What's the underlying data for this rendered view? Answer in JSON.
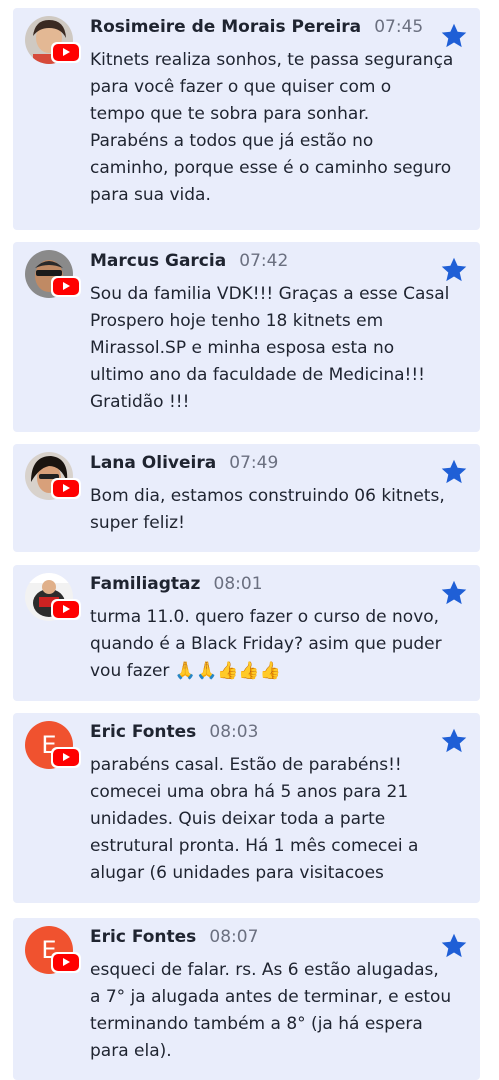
{
  "colors": {
    "card_bg": "#e9edfb",
    "star": "#1f5fd6",
    "youtube_red": "#ff0000",
    "avatar_letter_bg": "#f0522f"
  },
  "comments": [
    {
      "name": "Rosimeire de Morais Pereira",
      "time": "07:45",
      "lines": [
        "Kitnets realiza sonhos, te passa segurança",
        "para você fazer o que quiser com o",
        "tempo que te sobra para sonhar.",
        "Parabéns a todos que já estão no",
        "caminho, porque esse é o caminho seguro",
        "para sua vida."
      ],
      "avatar": "photo"
    },
    {
      "name": "Marcus Garcia",
      "time": "07:42",
      "lines": [
        "Sou da familia VDK!!! Graças a esse Casal",
        "Prospero hoje tenho 18 kitnets em",
        "Mirassol.SP e minha esposa esta no",
        "ultimo ano da faculdade de Medicina!!!",
        "Gratidão !!!"
      ],
      "avatar": "photo"
    },
    {
      "name": "Lana Oliveira",
      "time": "07:49",
      "lines": [
        "Bom dia, estamos construindo 06 kitnets,",
        "super feliz!"
      ],
      "avatar": "photo"
    },
    {
      "name": "Familiagtaz",
      "time": "08:01",
      "lines": [
        "turma 11.0. quero fazer o curso de novo,",
        "quando é a Black Friday? asim que puder",
        "vou fazer 🙏🙏👍👍👍"
      ],
      "avatar": "photo"
    },
    {
      "name": "Eric Fontes",
      "time": "08:03",
      "lines": [
        "parabéns casal. Estão de parabéns!!",
        "comecei uma obra há 5 anos para 21",
        "unidades. Quis deixar toda a parte",
        "estrutural pronta. Há 1 mês comecei a",
        "alugar (6 unidades para visitacoes"
      ],
      "avatar_letter": "E"
    },
    {
      "name": "Eric Fontes",
      "time": "08:07",
      "lines": [
        "esqueci de falar. rs. As 6 estão alugadas,",
        "a 7° ja alugada antes de terminar, e estou",
        "terminando também a 8° (ja há espera",
        "para ela)."
      ],
      "avatar_letter": "E"
    }
  ]
}
